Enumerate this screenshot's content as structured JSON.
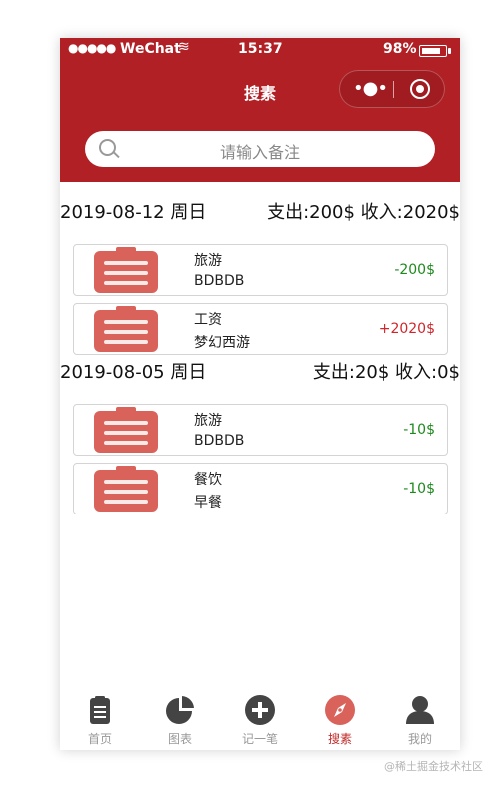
{
  "status": {
    "carrier": "WeChat",
    "time": "15:37",
    "battery": "98%"
  },
  "navbar": {
    "title": "搜素"
  },
  "search": {
    "placeholder": "请输入备注"
  },
  "groups": [
    {
      "date": "2019-08-12 周日",
      "totals": "支出:200$ 收入:2020$",
      "items": [
        {
          "category": "旅游",
          "note": "BDBDB",
          "amount": "-200$",
          "type": "expense"
        },
        {
          "category": "工资",
          "note": "梦幻西游",
          "amount": "+2020$",
          "type": "income"
        }
      ]
    },
    {
      "date": "2019-08-05 周日",
      "totals": "支出:20$ 收入:0$",
      "items": [
        {
          "category": "旅游",
          "note": "BDBDB",
          "amount": "-10$",
          "type": "expense"
        },
        {
          "category": "餐饮",
          "note": "早餐",
          "amount": "-10$",
          "type": "expense"
        }
      ]
    }
  ],
  "tabs": [
    {
      "label": "首页",
      "icon": "clipboard-icon",
      "active": false
    },
    {
      "label": "图表",
      "icon": "pie-chart-icon",
      "active": false
    },
    {
      "label": "记一笔",
      "icon": "plus-circle-icon",
      "active": false
    },
    {
      "label": "搜素",
      "icon": "compass-icon",
      "active": true
    },
    {
      "label": "我的",
      "icon": "user-icon",
      "active": false
    }
  ],
  "colors": {
    "brand": "#b02025",
    "expense": "#1e8a1e",
    "income": "#d0262b",
    "active_tab": "#c02a2a"
  },
  "watermark": "@稀土掘金技术社区"
}
